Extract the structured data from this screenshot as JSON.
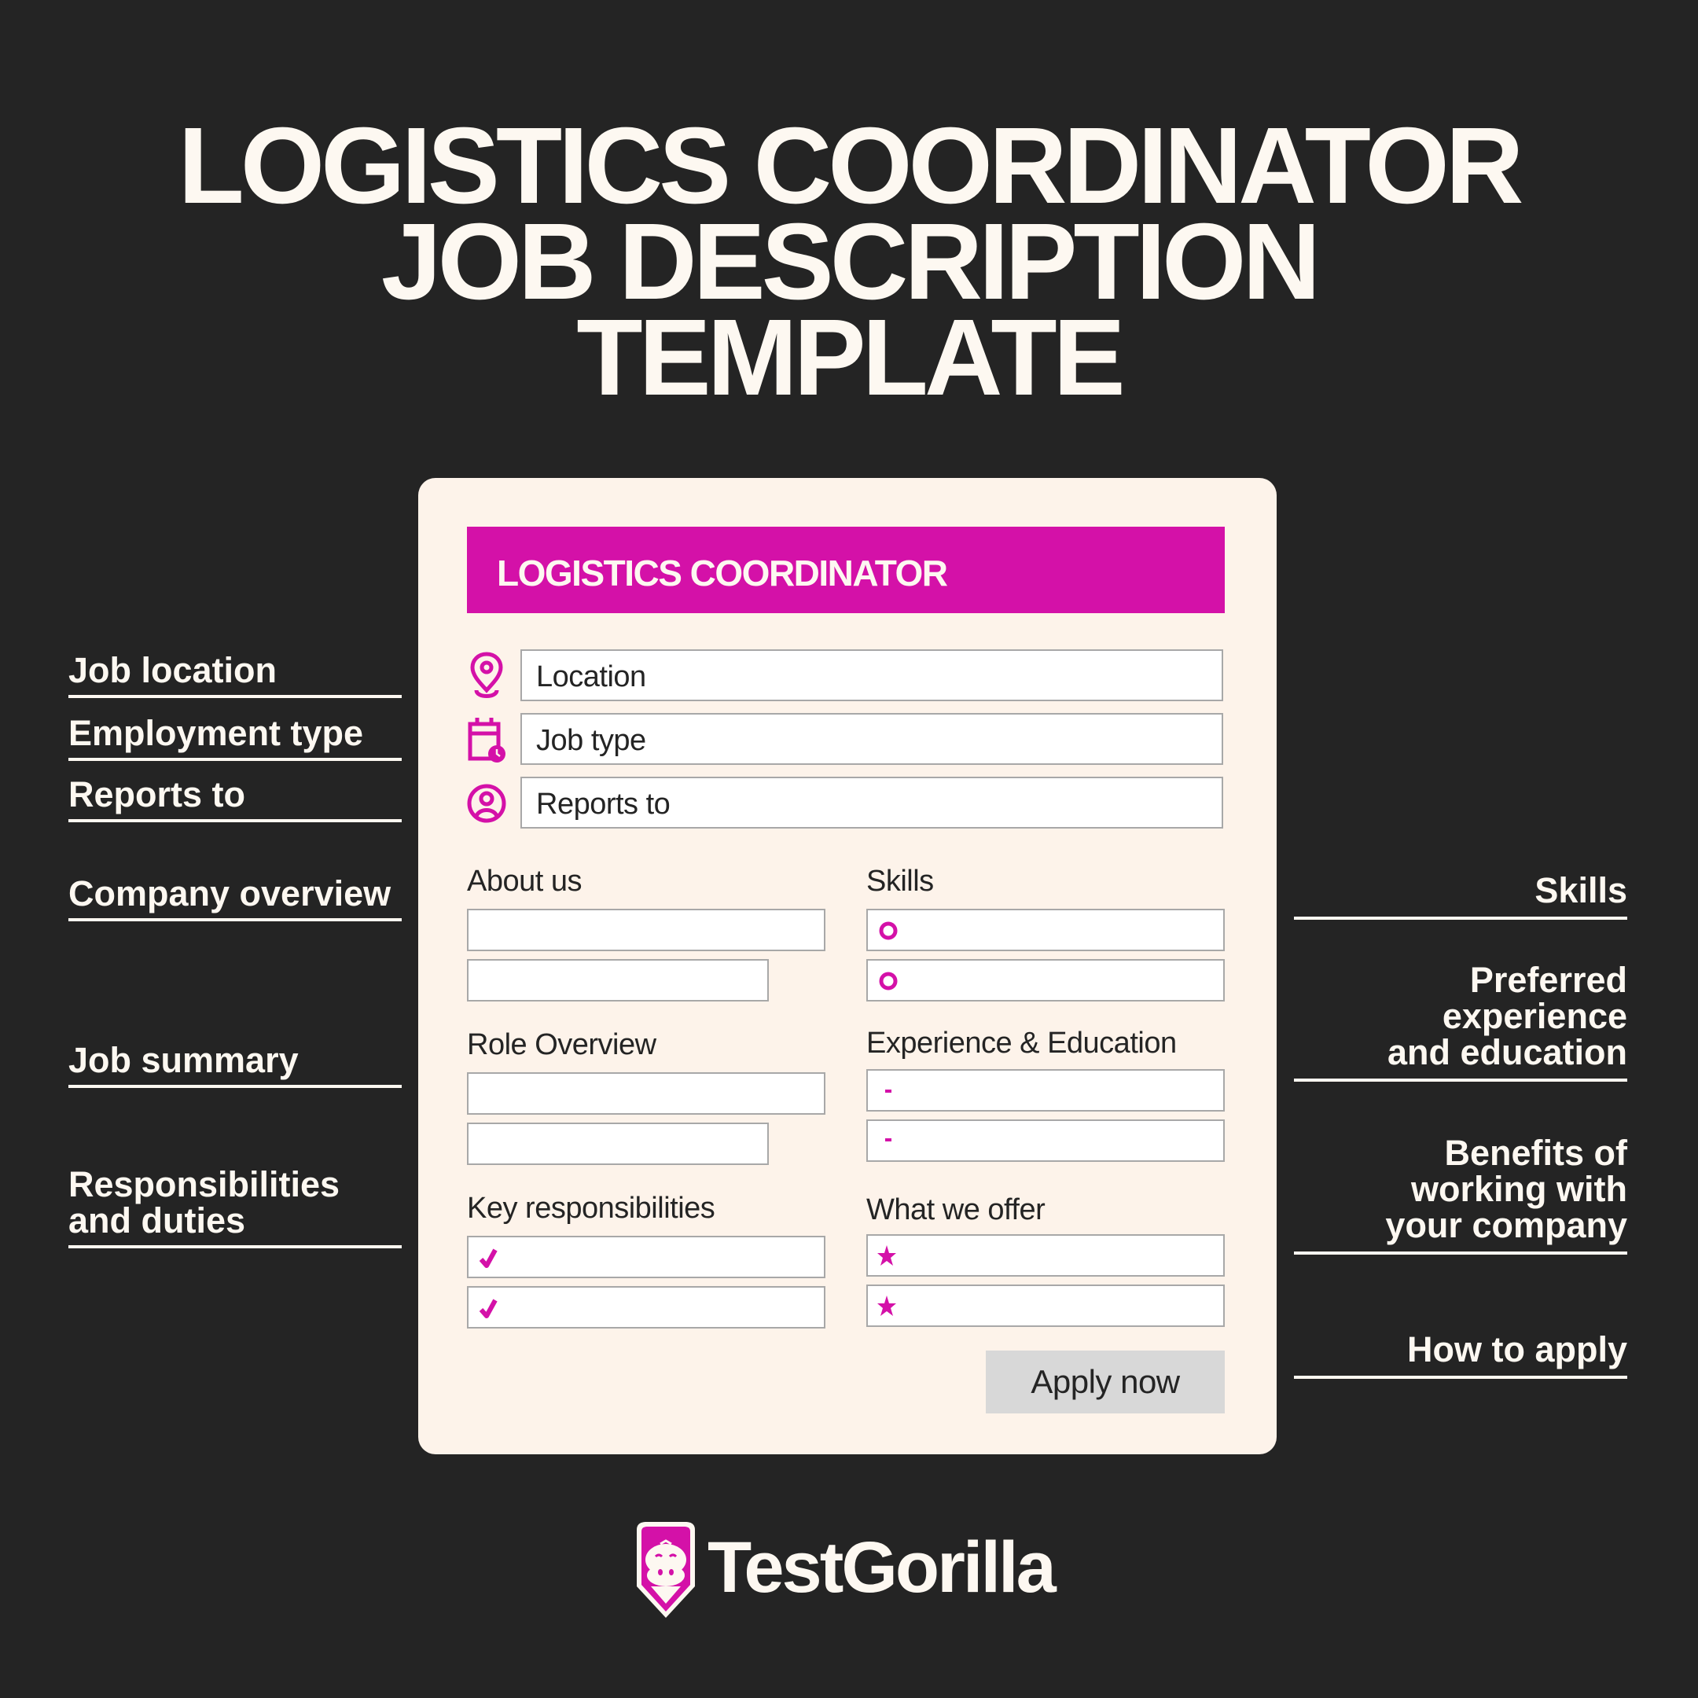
{
  "title": {
    "lines": [
      "LOGISTICS COORDINATOR",
      "JOB DESCRIPTION",
      "TEMPLATE"
    ]
  },
  "colors": {
    "background": "#242424",
    "card": "#fdf3ea",
    "accent": "#d411a8",
    "text_light": "#fdf8f1",
    "text_dark": "#242424",
    "button": "#d8d8d8",
    "border": "#a8a8a8"
  },
  "card": {
    "header": "LOGISTICS COORDINATOR",
    "fields": [
      {
        "icon": "location-pin-icon",
        "value": "Location"
      },
      {
        "icon": "calendar-clock-icon",
        "value": "Job type"
      },
      {
        "icon": "user-circle-icon",
        "value": "Reports to"
      }
    ],
    "sections": {
      "about_us": {
        "label": "About us",
        "bullet": "none",
        "lines": 2
      },
      "skills": {
        "label": "Skills",
        "bullet": "ring-bullet-icon",
        "lines": 2
      },
      "role_overview": {
        "label": "Role Overview",
        "bullet": "none",
        "lines": 2
      },
      "experience_education": {
        "label": "Experience & Education",
        "bullet": "dash-bullet-icon",
        "lines": 2
      },
      "key_responsibilities": {
        "label": "Key responsibilities",
        "bullet": "check-icon",
        "lines": 2
      },
      "what_we_offer": {
        "label": "What we offer",
        "bullet": "star-icon",
        "lines": 2
      }
    },
    "apply_button": "Apply now"
  },
  "left_labels": [
    [
      "Job location"
    ],
    [
      "Employment type"
    ],
    [
      "Reports to"
    ],
    [
      "Company overview"
    ],
    [
      "Job summary"
    ],
    [
      "Responsibilities",
      "and duties"
    ]
  ],
  "right_labels": [
    [
      "Skills"
    ],
    [
      "Preferred",
      "experience",
      "and education"
    ],
    [
      "Benefits of",
      "working with",
      "your company"
    ],
    [
      "How to apply"
    ]
  ],
  "brand": {
    "name": "TestGorilla",
    "logo_icon": "gorilla-shield-icon"
  }
}
